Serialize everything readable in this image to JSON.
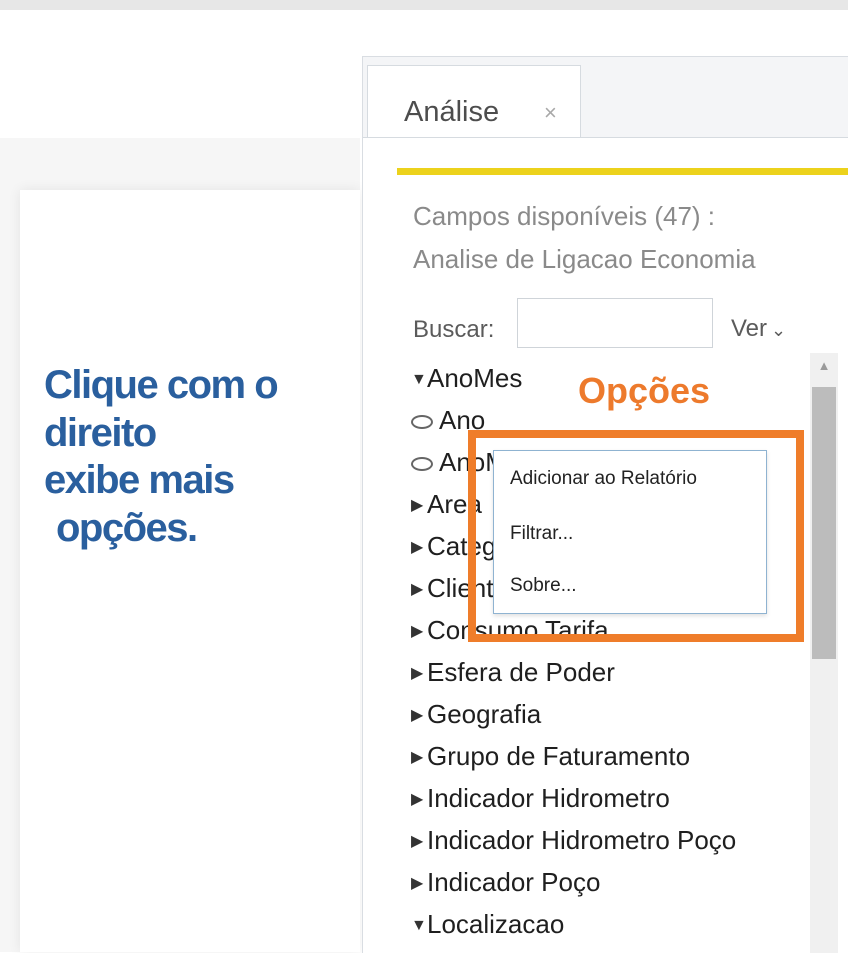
{
  "annotation": {
    "lines": [
      "Clique com o",
      "direito",
      "exibe mais",
      "opções."
    ],
    "options_label": "Opções",
    "color": "#2a5f9e",
    "highlight_color": "#ef7d2a"
  },
  "tab": {
    "label": "Análise",
    "close_icon": "×"
  },
  "panel": {
    "fields_count": "Campos disponíveis (47) :",
    "source_name": "Analise de Ligacao Economia",
    "search_label": "Buscar:",
    "search_value": "",
    "ver_label": "Ver",
    "accent_color": "#ecd21c"
  },
  "tree": [
    {
      "label": "AnoMes",
      "expanded": true,
      "type": "dimension"
    },
    {
      "label": "Ano",
      "type": "level"
    },
    {
      "label": "AnoMes",
      "type": "level"
    },
    {
      "label": "Area",
      "expanded": false,
      "type": "dimension"
    },
    {
      "label": "Categoria",
      "expanded": false,
      "type": "dimension"
    },
    {
      "label": "Cliente",
      "expanded": false,
      "type": "dimension"
    },
    {
      "label": "Consumo Tarifa",
      "expanded": false,
      "type": "dimension"
    },
    {
      "label": "Esfera de Poder",
      "expanded": false,
      "type": "dimension"
    },
    {
      "label": "Geografia",
      "expanded": false,
      "type": "dimension"
    },
    {
      "label": "Grupo de Faturamento",
      "expanded": false,
      "type": "dimension"
    },
    {
      "label": "Indicador Hidrometro",
      "expanded": false,
      "type": "dimension"
    },
    {
      "label": "Indicador Hidrometro Poço",
      "expanded": false,
      "type": "dimension"
    },
    {
      "label": "Indicador Poço",
      "expanded": false,
      "type": "dimension"
    },
    {
      "label": "Localizacao",
      "expanded": true,
      "type": "dimension"
    }
  ],
  "context_menu": {
    "items": [
      "Adicionar ao Relatório",
      "Filtrar...",
      "Sobre..."
    ]
  }
}
